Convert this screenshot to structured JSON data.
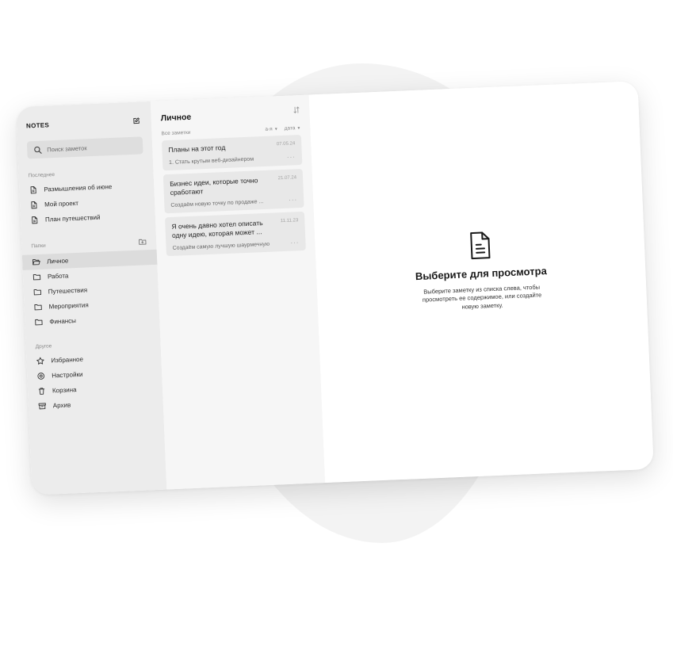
{
  "sidebar": {
    "title": "NOTES",
    "compose_icon": "compose-icon",
    "search": {
      "placeholder": "Поиск заметок",
      "value": ""
    },
    "recent": {
      "title": "Последнее",
      "items": [
        {
          "label": "Размышления об июне",
          "icon": "document-icon"
        },
        {
          "label": "Мой проект",
          "icon": "document-icon"
        },
        {
          "label": "План путешествий",
          "icon": "document-icon"
        }
      ]
    },
    "folders": {
      "title": "Папки",
      "add_icon": "new-folder-icon",
      "items": [
        {
          "label": "Личное",
          "icon": "folder-open-icon",
          "active": true
        },
        {
          "label": "Работа",
          "icon": "folder-icon"
        },
        {
          "label": "Путешествия",
          "icon": "folder-icon"
        },
        {
          "label": "Мероприятия",
          "icon": "folder-icon"
        },
        {
          "label": "Финансы",
          "icon": "folder-icon"
        }
      ]
    },
    "other": {
      "title": "Другое",
      "items": [
        {
          "label": "Избранное",
          "icon": "star-icon"
        },
        {
          "label": "Настройки",
          "icon": "settings-icon"
        },
        {
          "label": "Корзина",
          "icon": "trash-icon"
        },
        {
          "label": "Архив",
          "icon": "archive-icon"
        }
      ]
    }
  },
  "list": {
    "title": "Личное",
    "subtitle": "Все заметки",
    "sort_alpha": "а-я",
    "sort_date": "дата",
    "notes": [
      {
        "title": "Планы на этот год",
        "date": "07.05.24",
        "preview": "1. Стать крутым веб-дизайнером"
      },
      {
        "title": "Бизнес идеи, которые точно сработают",
        "date": "21.07.24",
        "preview": "Создаём новую точку по продаже ..."
      },
      {
        "title": "Я очень давно хотел описать одну идею, которая может ...",
        "date": "11.11.23",
        "preview": "Создаём самую лучшую шаурмечную"
      }
    ]
  },
  "empty_state": {
    "icon": "document-icon",
    "title": "Выберите для просмотра",
    "text": "Выберите заметку из списка слева, чтобы просмотреть ее содержимое, или создайте новую заметку."
  },
  "colors": {
    "sidebar_bg": "#ececec",
    "list_bg": "#f6f6f6",
    "card_bg": "#e8e8e8",
    "active_bg": "#dcdcdc",
    "background_blob": "#f3f3f3"
  }
}
